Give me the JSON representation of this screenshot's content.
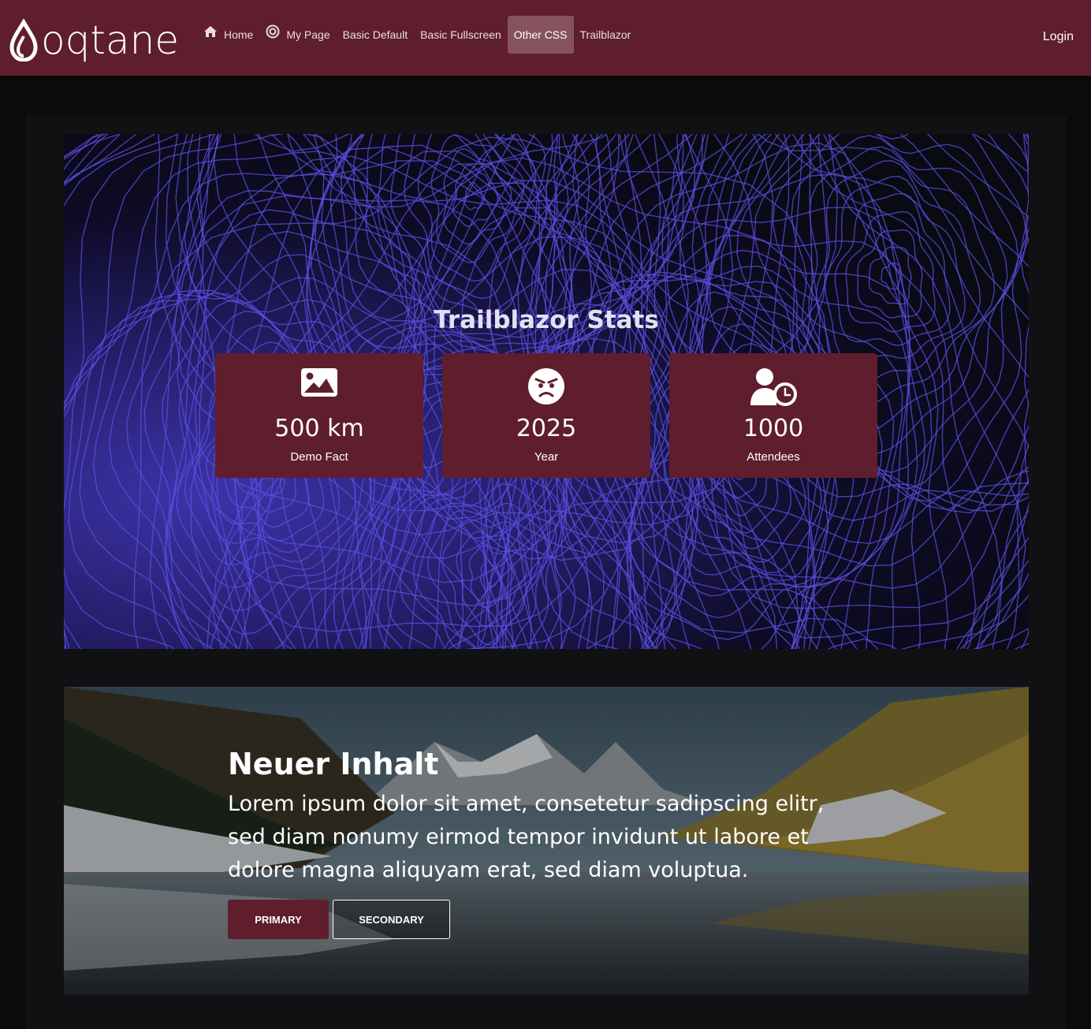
{
  "brand": {
    "logo_text": "oqtane"
  },
  "nav": {
    "items": [
      {
        "label": "Home",
        "icon": "home-icon"
      },
      {
        "label": "My Page",
        "icon": "target-icon"
      },
      {
        "label": "Basic Default"
      },
      {
        "label": "Basic Fullscreen"
      },
      {
        "label": "Other CSS",
        "active": true
      },
      {
        "label": "Trailblazor"
      }
    ],
    "login_label": "Login"
  },
  "hero": {
    "title": "Trailblazor Stats",
    "stats": [
      {
        "icon": "image-icon",
        "value": "500 km",
        "label": "Demo Fact"
      },
      {
        "icon": "angry-face-icon",
        "value": "2025",
        "label": "Year"
      },
      {
        "icon": "user-clock-icon",
        "value": "1000",
        "label": "Attendees"
      }
    ]
  },
  "banner": {
    "title": "Neuer Inhalt",
    "text": "Lorem ipsum dolor sit amet, consetetur sadipscing elitr, sed diam nonumy eirmod tempor invidunt ut labore et dolore magna aliquyam erat, sed diam voluptua.",
    "primary_label": "PRIMARY",
    "secondary_label": "SECONDARY"
  },
  "colors": {
    "brand": "#5f1e2d",
    "active_nav": "#86525f",
    "page_bg": "#0b0b0c",
    "topo_line": "#5b4fe0"
  }
}
